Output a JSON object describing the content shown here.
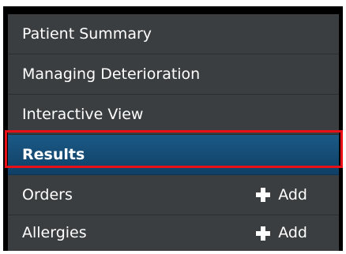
{
  "menu": {
    "items": [
      {
        "label": "Patient Summary"
      },
      {
        "label": "Managing Deterioration"
      },
      {
        "label": "Interactive View"
      },
      {
        "label": "Results",
        "selected": true
      },
      {
        "label": "Orders",
        "action": "Add"
      },
      {
        "label": "Allergies",
        "action": "Add"
      }
    ]
  },
  "colors": {
    "panel": "#3b3e40",
    "selected": "#0f4f7a",
    "highlight": "#e80f16",
    "text": "#ffffff"
  },
  "icons": {
    "add": "plus-icon"
  }
}
